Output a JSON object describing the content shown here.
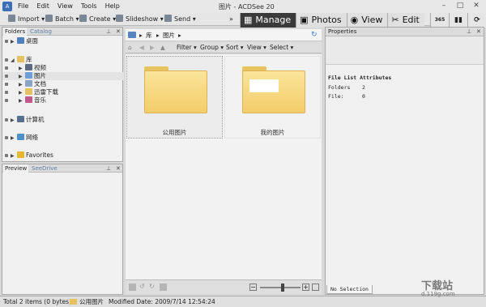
{
  "window": {
    "title": "图片 - ACDSee 20",
    "menu": [
      "File",
      "Edit",
      "View",
      "Tools",
      "Help"
    ]
  },
  "toolbar": {
    "import": "Import ▾",
    "batch": "Batch ▾",
    "create": "Create ▾",
    "slideshow": "Slideshow ▾",
    "send": "Send ▾",
    "more": "»"
  },
  "modes": {
    "manage": "Manage",
    "photos": "Photos",
    "view": "View",
    "edit": "Edit",
    "badge": "365"
  },
  "folders_panel": {
    "tab_folders": "Folders",
    "tab_catalog": "Catalog",
    "items": {
      "desktop": "桌面",
      "library": "库",
      "videos": "视频",
      "pictures": "图片",
      "documents": "文档",
      "downloads": "迅雷下载",
      "music": "音乐",
      "computer": "计算机",
      "network": "网络",
      "favorites": "Favorites"
    }
  },
  "preview_panel": {
    "tab_preview": "Preview",
    "tab_seedrive": "SeeDrive"
  },
  "path": {
    "segment1": "库",
    "segment2": "图片"
  },
  "filterbar": {
    "filter": "Filter ▾",
    "group": "Group ▾",
    "sort": "Sort ▾",
    "view": "View ▾",
    "select": "Select ▾"
  },
  "files": [
    {
      "name": "公用图片"
    },
    {
      "name": "我的图片"
    }
  ],
  "properties": {
    "title": "Properties",
    "section": "File List Attributes",
    "folders_label": "Folders",
    "folders_value": "2",
    "files_label": "File:",
    "files_value": "0",
    "no_selection": "No Selection"
  },
  "status": {
    "total": "Total 2 items  (0 bytes)",
    "folder": "公用图片",
    "modified": "Modified Date: 2009/7/14 12:54:24"
  },
  "watermark": {
    "site_cn": "下载站",
    "site_url": "d.119g.com"
  }
}
